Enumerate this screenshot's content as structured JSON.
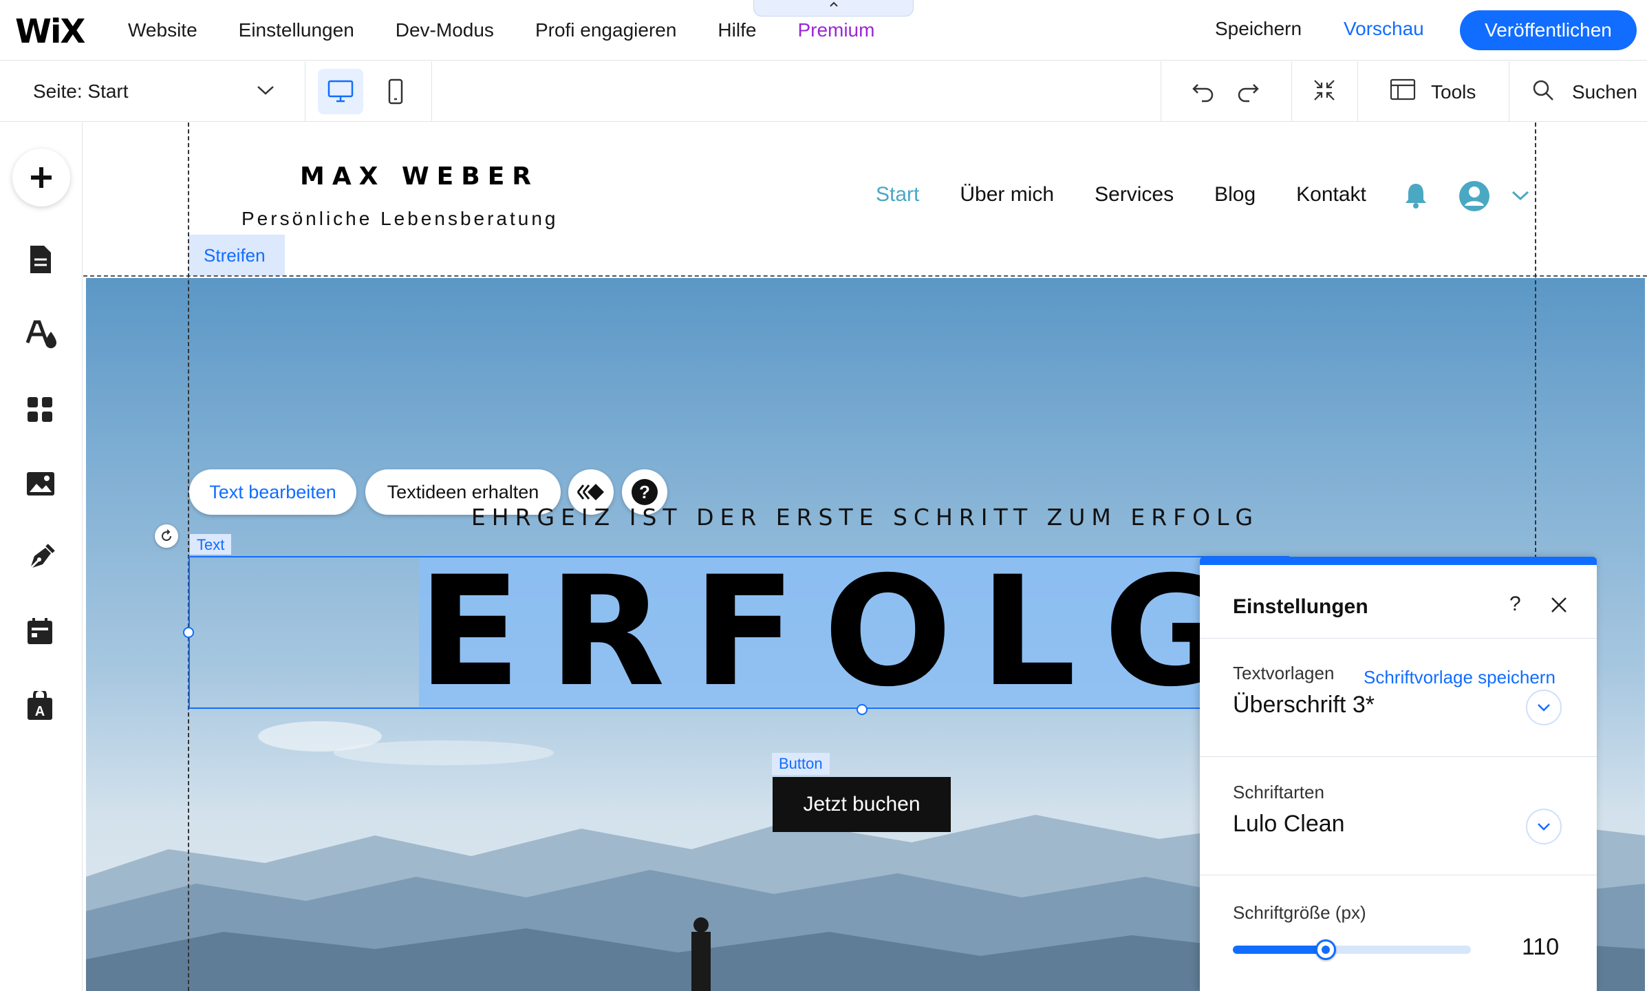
{
  "topbar": {
    "logo": "WiX",
    "menu": [
      "Website",
      "Einstellungen",
      "Dev-Modus",
      "Profi engagieren",
      "Hilfe",
      "Premium"
    ],
    "pulltab_icon": "chevron-up-icon",
    "save_label": "Speichern",
    "preview_label": "Vorschau",
    "publish_label": "Veröffentlichen"
  },
  "toolbar": {
    "page_prefix": "Seite:",
    "page_name": "Start",
    "tools_label": "Tools",
    "search_label": "Suchen"
  },
  "leftbar": {
    "icons": [
      "add-icon",
      "pages-icon",
      "design-icon",
      "apps-icon",
      "media-icon",
      "blog-icon",
      "bookings-icon",
      "business-icon"
    ]
  },
  "site": {
    "name": "MAX WEBER",
    "tagline": "Persönliche Lebensberatung",
    "nav": [
      "Start",
      "Über mich",
      "Services",
      "Blog",
      "Kontakt"
    ],
    "nav_active": "Start",
    "strip_label": "Streifen"
  },
  "hero": {
    "edit_text_label": "Text bearbeiten",
    "text_ideas_label": "Textideen erhalten",
    "subheading": "EHRGEIZ IST DER ERSTE SCHRITT ZUM ERFOLG",
    "text_tag": "Text",
    "headline": "ERFOLG",
    "button_tag": "Button",
    "cta_label": "Jetzt buchen"
  },
  "panel": {
    "title": "Einstellungen",
    "help": "?",
    "text_styles_label": "Textvorlagen",
    "save_style_link": "Schriftvorlage speichern",
    "text_style_value": "Überschrift 3*",
    "fonts_label": "Schriftarten",
    "font_value": "Lulo Clean",
    "font_size_label": "Schriftgröße (px)",
    "font_size_value": "110",
    "font_size_fraction": 0.39
  },
  "colors": {
    "accent": "#116dff",
    "premium": "#9a27d5",
    "site_nav_active": "#4aa8c2",
    "selection": "#8cbef5"
  }
}
